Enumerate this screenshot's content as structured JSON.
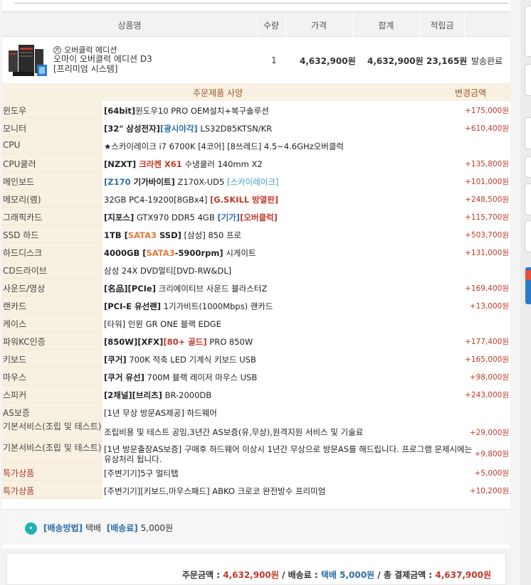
{
  "header": {
    "product_name": "상품명",
    "qty": "수량",
    "price": "가격",
    "total": "합계",
    "points": "적립금"
  },
  "product": {
    "brand": "오버클럭 에디션",
    "name_line1": "오마이 오버클럭 에디션 D3",
    "name_line2": "[프리미엄 시스템]",
    "qty": "1",
    "price": "4,632,900원",
    "total": "4,632,900원",
    "points": "23,165원",
    "status": "발송완료"
  },
  "spec": {
    "title": "주문제품 사양",
    "change_title": "변경금액",
    "rows": [
      {
        "label": "윈도우",
        "amount": "+175,000원"
      },
      {
        "label": "모니터",
        "amount": "+610,400원"
      },
      {
        "label": "CPU",
        "amount": ""
      },
      {
        "label": "CPU쿨러",
        "amount": "+135,800원"
      },
      {
        "label": "메인보드",
        "amount": "+101,000원"
      },
      {
        "label": "메모리(램)",
        "amount": "+248,500원"
      },
      {
        "label": "그래픽카드",
        "amount": "+115,700원"
      },
      {
        "label": "SSD 하드",
        "amount": "+503,700원"
      },
      {
        "label": "하드디스크",
        "amount": "+131,000원"
      },
      {
        "label": "CD드라이브",
        "amount": ""
      },
      {
        "label": "사운드/영상",
        "amount": "+169,400원"
      },
      {
        "label": "랜카드",
        "amount": "+13,000원"
      },
      {
        "label": "케이스",
        "amount": ""
      },
      {
        "label": "파워KC인증",
        "amount": "+177,400원"
      },
      {
        "label": "키보드",
        "amount": "+165,000원"
      },
      {
        "label": "마우스",
        "amount": "+98,000원"
      },
      {
        "label": "스피커",
        "amount": "+243,000원"
      },
      {
        "label": "AS보증",
        "amount": ""
      },
      {
        "label": "기본서비스(조립 및 테스트)",
        "amount": "+29,000원"
      },
      {
        "label": "기본서비스(조립 및 테스트)",
        "amount": "+9,800원"
      },
      {
        "label": "특가상품",
        "amount": "+5,000원"
      },
      {
        "label": "특가상품",
        "amount": "+10,200원"
      }
    ],
    "values": {
      "win_a": "[64bit]",
      "win_b": "윈도우10 PRO OEM설치+복구솔루션",
      "mon_a": "[32\" 삼성전자]",
      "mon_b": "[광시야각]",
      "mon_c": " LS32D85KTSN/KR",
      "cpu": "★스카이레이크 i7 6700K [4코어] [8쓰레드] 4.5~4.6GHz오버클럭",
      "cool_a": "[NZXT]",
      "cool_b": " 크라켄 X61",
      "cool_c": " 수냉쿨러 140mm X2",
      "mb_a": "[Z170",
      "mb_b": " 기가바이트]",
      "mb_c": " Z170X-UD5 ",
      "mb_d": "[스카이레이크]",
      "ram_a": "32GB PC4-19200[8GBx4] ",
      "ram_b": "[G.SKILL 방열판]",
      "gpu_a": "[지포스]",
      "gpu_b": " GTX970 DDR5 4GB ",
      "gpu_c": "[기가]",
      "gpu_d": "[오버클럭]",
      "ssd_a": "1TB [",
      "ssd_b": "SATA3",
      "ssd_c": " SSD]",
      "ssd_d": " [삼성] 850 프로",
      "hdd_a": "4000GB [",
      "hdd_b": "SATA3",
      "hdd_c": "-5900rpm]",
      "hdd_d": " 시게이트",
      "cd": "삼성 24X DVD멀티[DVD-RW&DL]",
      "snd_a": "[名品][PCIe]",
      "snd_b": " 크리에이티브 사운드 블라스터Z",
      "lan_a": "[PCI-E 유선랜]",
      "lan_b": " 1기가비트(1000Mbps) 랜카드",
      "case": "[타워] 인윈 GR ONE 블랙 EDGE",
      "psu_a": "[850W][XFX]",
      "psu_b": "[80+ 골드]",
      "psu_c": " PRO 850W",
      "kb_a": "[쿠거]",
      "kb_b": " 700K 적축 LED 기계식 키보드 USB",
      "ms_a": "[쿠거 유선]",
      "ms_b": " 700M 블랙 레이저 마우스 USB",
      "spk_a": "[2채널][브리츠]",
      "spk_b": " BR-2000DB",
      "as": "[1년 무상 방문AS제공] 하드웨어",
      "svc1": "조립비용 및 테스트 공임,3년간 AS보증(유,무상),원격지원 서비스 및 기술료",
      "svc2": "[1년 방문출장AS보증] 구매후 하드웨어 이상시 1년간 무상으로 방문AS를 해드립니다. 프로그램 문제시에는 유상처리 됩니다.",
      "sp1": "[주변기기]5구 멀티탭",
      "sp2": "[주변기기][키보드,마우스패드] ABKO 크로코 완전방수 프리미엄"
    }
  },
  "delivery": {
    "method_label": "[배송방법]",
    "method": "택배",
    "fee_label": "[배송료]",
    "fee": "5,000원"
  },
  "summary": {
    "order_label": "주문금액 : ",
    "order_amount": "4,632,900원",
    "sep1": " / 배송료 : ",
    "ship_amount": "택배 5,000원",
    "sep2": " / 총 결제금액 : ",
    "final_amount": "4,637,900원"
  },
  "colors": {
    "accent_red": "#c0392b",
    "accent_blue": "#2f6ea9",
    "label_bg": "#f8f0e0"
  }
}
